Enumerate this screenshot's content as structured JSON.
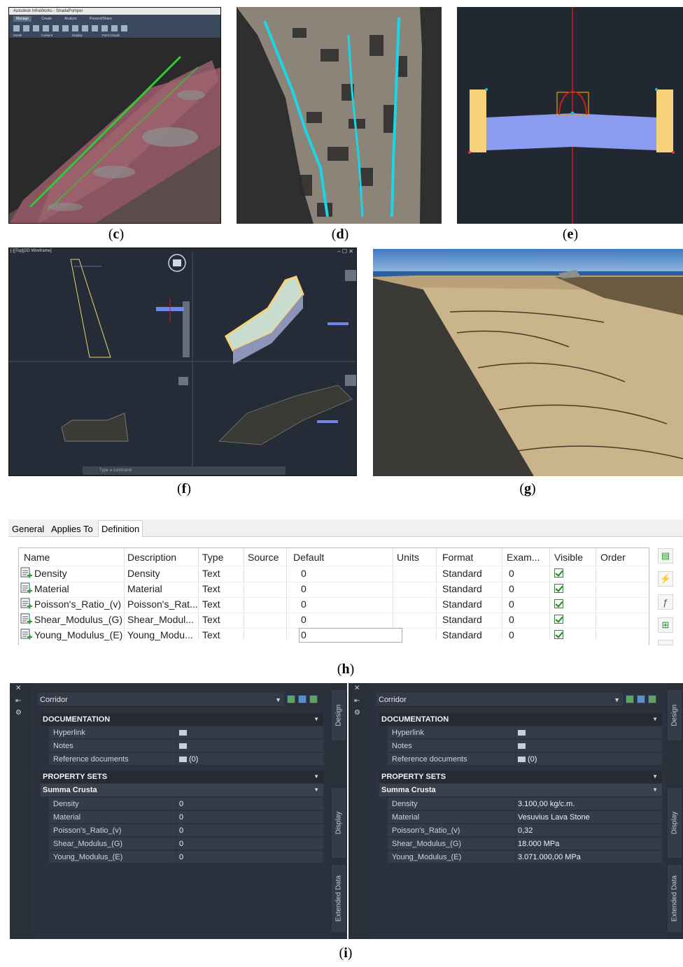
{
  "captions": {
    "c": "c",
    "d": "d",
    "e": "e",
    "f": "f",
    "g": "g",
    "h": "h",
    "i": "i"
  },
  "panel_c": {
    "window_title": "Autodesk InfraWorks - StradaPompei",
    "ribbon_tabs": [
      "Manage",
      "Create",
      "Analyze",
      "Present/Share"
    ],
    "ribbon_groups": [
      "Model",
      "Content",
      "Display",
      "Point Clouds"
    ]
  },
  "panel_f": {
    "viewport_label": "[-][Top][2D Wireframe]",
    "command_placeholder": "Type a command"
  },
  "definition_editor": {
    "tabs": [
      "General",
      "Applies To",
      "Definition"
    ],
    "columns": [
      "Name",
      "Description",
      "Type",
      "Source",
      "Default",
      "Units",
      "Format",
      "Exam...",
      "Visible",
      "Order"
    ],
    "rows": [
      {
        "name": "Density",
        "description": "Density",
        "type": "Text",
        "source": "",
        "default": "0",
        "units": "",
        "format": "Standard",
        "example": "0",
        "visible": true
      },
      {
        "name": "Material",
        "description": "Material",
        "type": "Text",
        "source": "",
        "default": "0",
        "units": "",
        "format": "Standard",
        "example": "0",
        "visible": true
      },
      {
        "name": "Poisson's_Ratio_(v)",
        "description": "Poisson's_Rat...",
        "type": "Text",
        "source": "",
        "default": "0",
        "units": "",
        "format": "Standard",
        "example": "0",
        "visible": true
      },
      {
        "name": "Shear_Modulus_(G)",
        "description": "Shear_Modul...",
        "type": "Text",
        "source": "",
        "default": "0",
        "units": "",
        "format": "Standard",
        "example": "0",
        "visible": true
      },
      {
        "name": "Young_Modulus_(E)",
        "description": "Young_Modu...",
        "type": "Text",
        "source": "",
        "default": "0",
        "units": "",
        "format": "Standard",
        "example": "0",
        "visible": true
      }
    ]
  },
  "properties_left": {
    "object_type": "Corridor",
    "documentation_header": "DOCUMENTATION",
    "documentation": [
      {
        "label": "Hyperlink",
        "value": ""
      },
      {
        "label": "Notes",
        "value": ""
      },
      {
        "label": "Reference documents",
        "value": "(0)"
      }
    ],
    "property_sets_header": "PROPERTY SETS",
    "set_name": "Summa Crusta",
    "properties": [
      {
        "label": "Density",
        "value": "0"
      },
      {
        "label": "Material",
        "value": "0"
      },
      {
        "label": "Poisson's_Ratio_(v)",
        "value": "0"
      },
      {
        "label": "Shear_Modulus_(G)",
        "value": "0"
      },
      {
        "label": "Young_Modulus_(E)",
        "value": "0"
      }
    ],
    "side_tabs": [
      "Design",
      "Display",
      "Extended Data"
    ]
  },
  "properties_right": {
    "object_type": "Corridor",
    "documentation_header": "DOCUMENTATION",
    "documentation": [
      {
        "label": "Hyperlink",
        "value": ""
      },
      {
        "label": "Notes",
        "value": ""
      },
      {
        "label": "Reference documents",
        "value": "(0)"
      }
    ],
    "property_sets_header": "PROPERTY SETS",
    "set_name": "Summa Crusta",
    "properties": [
      {
        "label": "Density",
        "value": "3.100,00 kg/c.m."
      },
      {
        "label": "Material",
        "value": "Vesuvius Lava Stone"
      },
      {
        "label": "Poisson's_Ratio_(v)",
        "value": "0,32"
      },
      {
        "label": "Shear_Modulus_(G)",
        "value": "18.000 MPa"
      },
      {
        "label": "Young_Modulus_(E)",
        "value": "3.071.000,00 MPa"
      }
    ],
    "side_tabs": [
      "Design",
      "Display",
      "Extended Data"
    ]
  },
  "colors": {
    "accent_cyan": "#19d7e6",
    "subassembly_blue": "#8b9cf0",
    "curb_yellow": "#f7d27a",
    "axis_red": "#d11a1a",
    "palette_bg": "#2c323d"
  }
}
